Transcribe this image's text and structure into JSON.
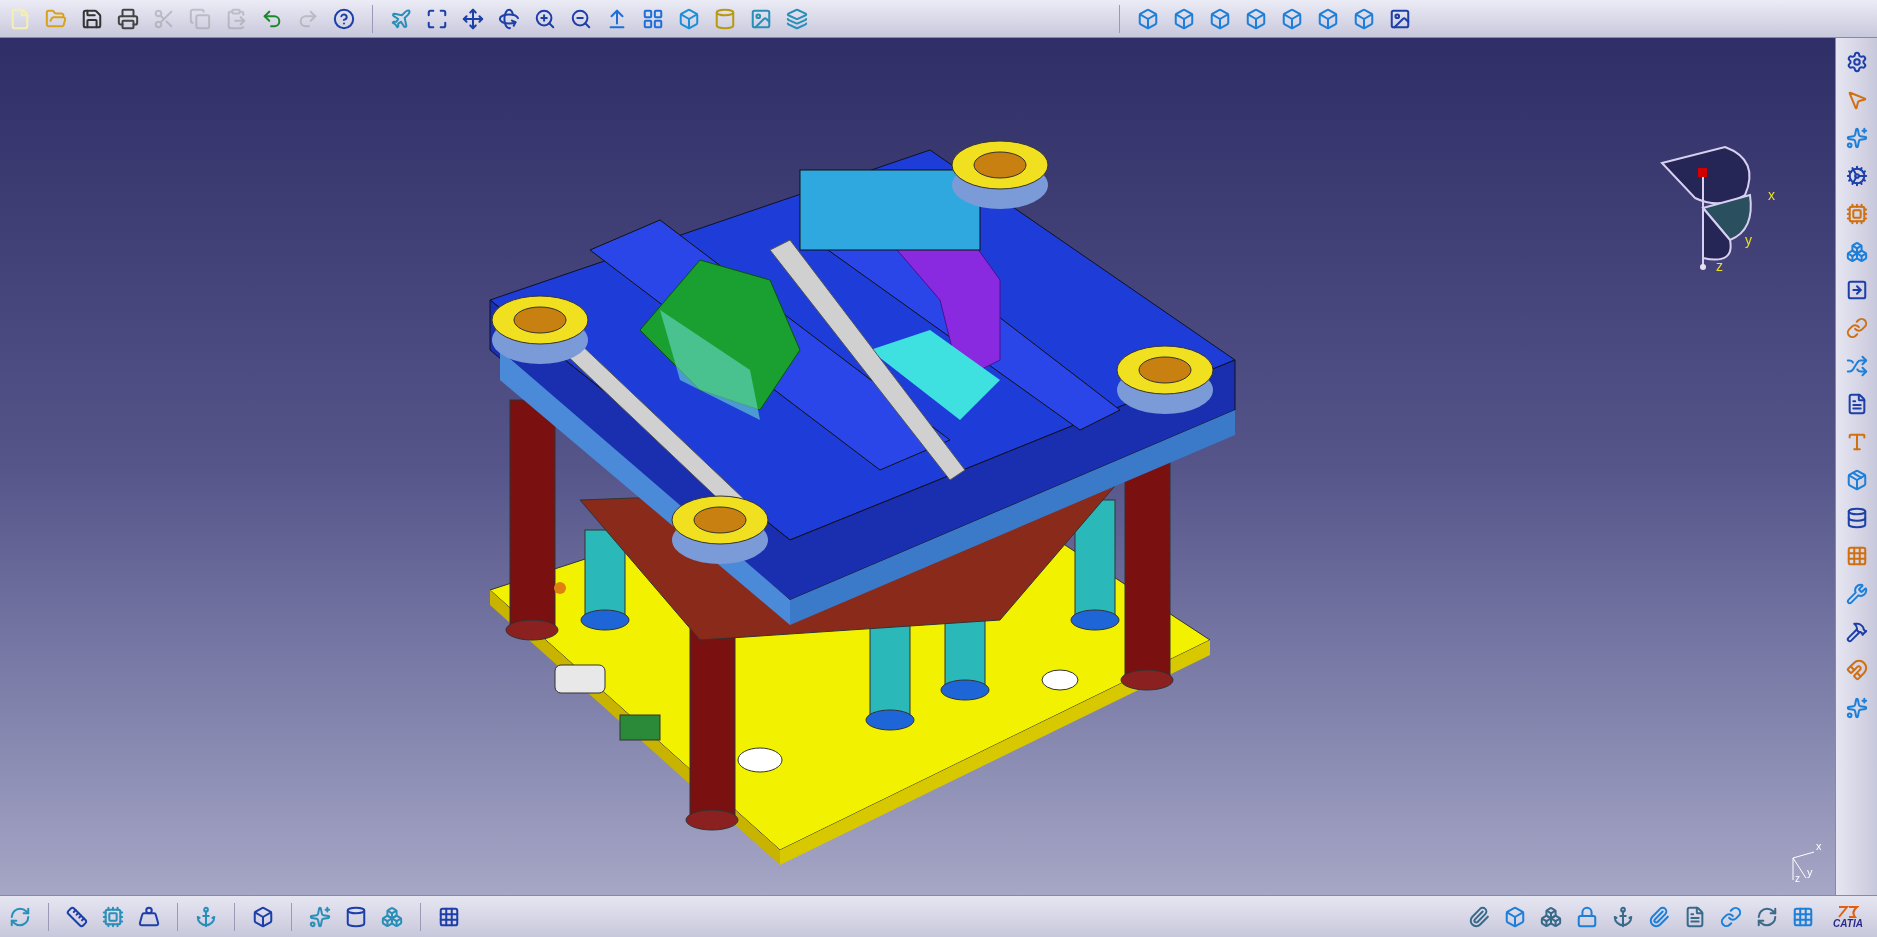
{
  "top_toolbar": {
    "buttons": [
      {
        "disabled": false
      },
      {
        "disabled": false
      },
      {
        "disabled": false
      },
      {
        "disabled": false
      },
      {
        "disabled": true
      },
      {
        "disabled": true
      },
      {
        "disabled": true
      },
      {
        "disabled": false
      },
      {
        "disabled": true
      },
      {
        "disabled": false
      }
    ]
  },
  "compass": {
    "x_label": "x",
    "y_label": "y",
    "z_label": "z"
  },
  "axis_indicator": {
    "x_label": "x",
    "y_label": "y",
    "z_label": "z"
  },
  "logo": {
    "text": "CATIA"
  }
}
